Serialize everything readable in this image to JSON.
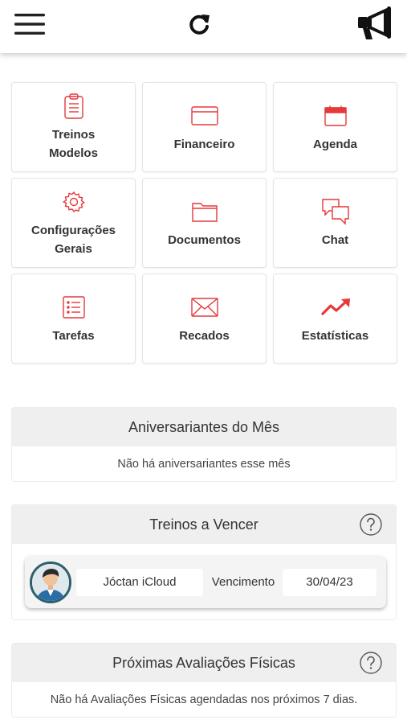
{
  "header": {
    "menu_icon": "hamburger-menu-icon",
    "refresh_icon": "refresh-icon",
    "announce_icon": "megaphone-icon"
  },
  "accent_color": "#e5393b",
  "tiles": [
    {
      "label": "Treinos\nModelos",
      "icon": "clipboard-icon"
    },
    {
      "label": "Financeiro",
      "icon": "credit-card-icon"
    },
    {
      "label": "Agenda",
      "icon": "calendar-icon"
    },
    {
      "label": "Configurações\nGerais",
      "icon": "gear-icon"
    },
    {
      "label": "Documentos",
      "icon": "folder-icon"
    },
    {
      "label": "Chat",
      "icon": "chat-bubbles-icon"
    },
    {
      "label": "Tarefas",
      "icon": "task-list-icon"
    },
    {
      "label": "Recados",
      "icon": "envelope-icon"
    },
    {
      "label": "Estatísticas",
      "icon": "trending-up-icon"
    }
  ],
  "birthdays": {
    "title": "Aniversariantes do Mês",
    "empty_text": "Não há aniversariantes esse mês"
  },
  "trainings_due": {
    "title": "Treinos a Vencer",
    "help_icon": "question-circle-icon",
    "rows": [
      {
        "name": "Jóctan iCloud",
        "due_label": "Vencimento",
        "due_date": "30/04/23",
        "avatar_icon": "user-avatar-icon"
      }
    ]
  },
  "evaluations": {
    "title": "Próximas Avaliações Físicas",
    "help_icon": "question-circle-icon",
    "empty_text": "Não há Avaliações Físicas agendadas nos próximos 7 dias."
  }
}
